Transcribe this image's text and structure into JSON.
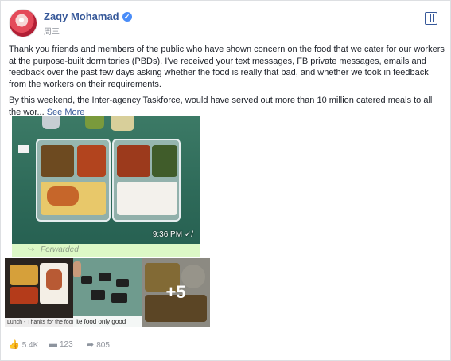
{
  "post": {
    "author_name": "Zaqy Mohamad",
    "verified_glyph": "✓",
    "timestamp": "周三",
    "paragraph_1": "Thank you friends and members of the public who have shown concern on the food that we cater for our workers at the purpose-built dormitories (PBDs). I've received your text messages, FB private messages, emails and feedback over the past few days asking whether the food is really that bad, and whether we took in feedback from the workers on their requirements.",
    "paragraph_2": "By this weekend, the Inter-agency Taskforce, would have served out more than 10 million catered meals to all the wor...",
    "see_more": "See More"
  },
  "main_photo": {
    "time": "9:36 PM ✓/",
    "forwarded_label": "Forwarded",
    "forwarded_icon": "↪"
  },
  "thumbnails": [
    {
      "caption": "Lunch - Thanks for the food"
    },
    {
      "caption": "ite food only good"
    },
    {
      "overlay": "+5"
    }
  ],
  "footer": {
    "likes_icon": "like-icon",
    "likes": "5.4K",
    "comments_icon": "comment-icon",
    "comments": "123",
    "shares_icon": "share-icon",
    "shares": "805"
  }
}
